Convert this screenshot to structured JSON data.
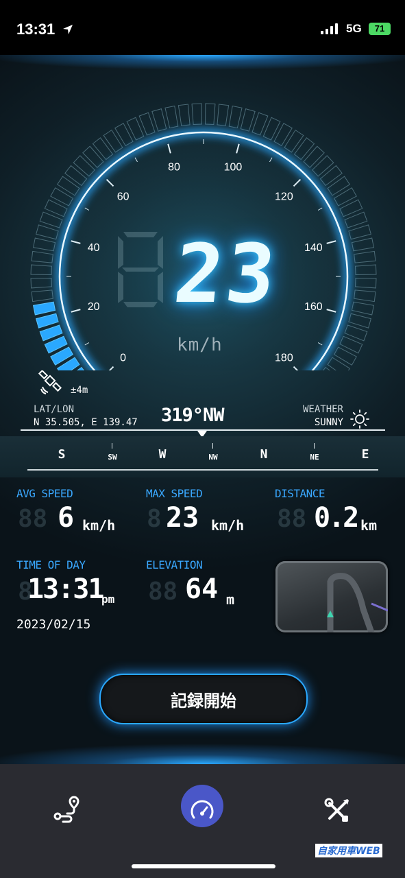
{
  "status_bar": {
    "time": "13:31",
    "network": "5G",
    "battery": "71"
  },
  "speedometer": {
    "speed": "23",
    "unit": "km/h",
    "scale_labels": [
      "0",
      "20",
      "40",
      "60",
      "80",
      "100",
      "120",
      "140",
      "160",
      "180"
    ],
    "max_speed": 180
  },
  "gps": {
    "accuracy": "±4m"
  },
  "location": {
    "label": "LAT/LON",
    "value": "N 35.505, E 139.47"
  },
  "heading": {
    "value": "319°NW"
  },
  "weather": {
    "label": "WEATHER",
    "value": "SUNNY"
  },
  "compass": {
    "directions": [
      "S",
      "SW",
      "W",
      "NW",
      "N",
      "NE",
      "E"
    ]
  },
  "stats": {
    "avg_speed": {
      "label": "AVG SPEED",
      "value": "6",
      "unit": "km/h"
    },
    "max_speed": {
      "label": "MAX SPEED",
      "value": "23",
      "unit": "km/h"
    },
    "distance": {
      "label": "DISTANCE",
      "value": "0.2",
      "unit": "km"
    },
    "time_of_day": {
      "label": "TIME OF DAY",
      "value": "13:31",
      "unit": "pm",
      "date": "2023/02/15"
    },
    "elevation": {
      "label": "ELEVATION",
      "value": "64",
      "unit": "m"
    }
  },
  "record_button": {
    "label": "記録開始"
  },
  "tab_bar": {
    "tabs": [
      "route",
      "speedometer",
      "settings"
    ],
    "active": "speedometer"
  },
  "watermark": {
    "text": "自家用車WEB"
  },
  "colors": {
    "accent": "#2aa8ff",
    "label": "#3aa8ff",
    "tab_active": "#4a57c8"
  }
}
